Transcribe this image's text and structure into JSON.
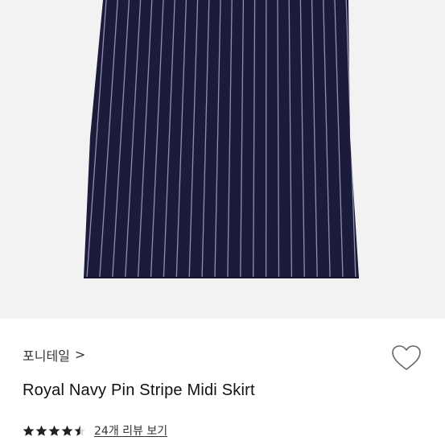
{
  "product": {
    "image_alt": "Royal Navy Pin Stripe Midi Skirt",
    "colors": {
      "fabric": "#1b1c3c",
      "stripe": "#b9b6cf",
      "background": "#f2f2f2"
    }
  },
  "info": {
    "brand": "포니테일",
    "brand_chevron": ">",
    "title": "Royal Navy Pin Stripe Midi Skirt",
    "rating": {
      "value": 4.5,
      "max": 5
    },
    "review_link": "24개 리뷰 보기",
    "wishlist_icon": "heart-outline-icon"
  }
}
